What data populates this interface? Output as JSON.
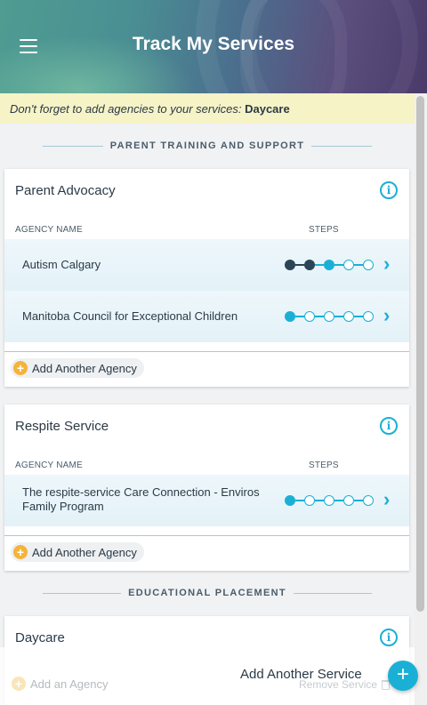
{
  "header": {
    "title": "Track My Services",
    "menu_icon": "hamburger-menu-icon"
  },
  "reminder": {
    "prefix": "Don't forget to add agencies to your services:",
    "service": "Daycare"
  },
  "colors": {
    "accent": "#1ab0d5",
    "done_step": "#2b4456",
    "add_plus": "#f3b43a",
    "reminder_bg": "#f6f3c7"
  },
  "sections": [
    {
      "heading": "PARENT TRAINING AND SUPPORT"
    },
    {
      "heading": "EDUCATIONAL PLACEMENT"
    }
  ],
  "cards": [
    {
      "title": "Parent Advocacy",
      "col_agency": "AGENCY NAME",
      "col_steps": "STEPS",
      "agencies": [
        {
          "name": "Autism Calgary",
          "steps": [
            "done",
            "done",
            "current",
            "todo",
            "todo"
          ]
        },
        {
          "name": "Manitoba Council for Exceptional Children",
          "steps": [
            "current",
            "todo",
            "todo",
            "todo",
            "todo"
          ]
        }
      ],
      "add_label": "Add Another Agency"
    },
    {
      "title": "Respite Service",
      "col_agency": "AGENCY NAME",
      "col_steps": "STEPS",
      "agencies": [
        {
          "name": "The respite-service Care Connection - Enviros Family Program",
          "steps": [
            "current",
            "todo",
            "todo",
            "todo",
            "todo"
          ]
        }
      ],
      "add_label": "Add Another Agency"
    },
    {
      "title": "Daycare",
      "add_label": "Add an Agency",
      "remove_label": "Remove Service"
    }
  ],
  "footer": {
    "add_service_label": "Add Another Service",
    "fab_icon": "plus-icon"
  }
}
